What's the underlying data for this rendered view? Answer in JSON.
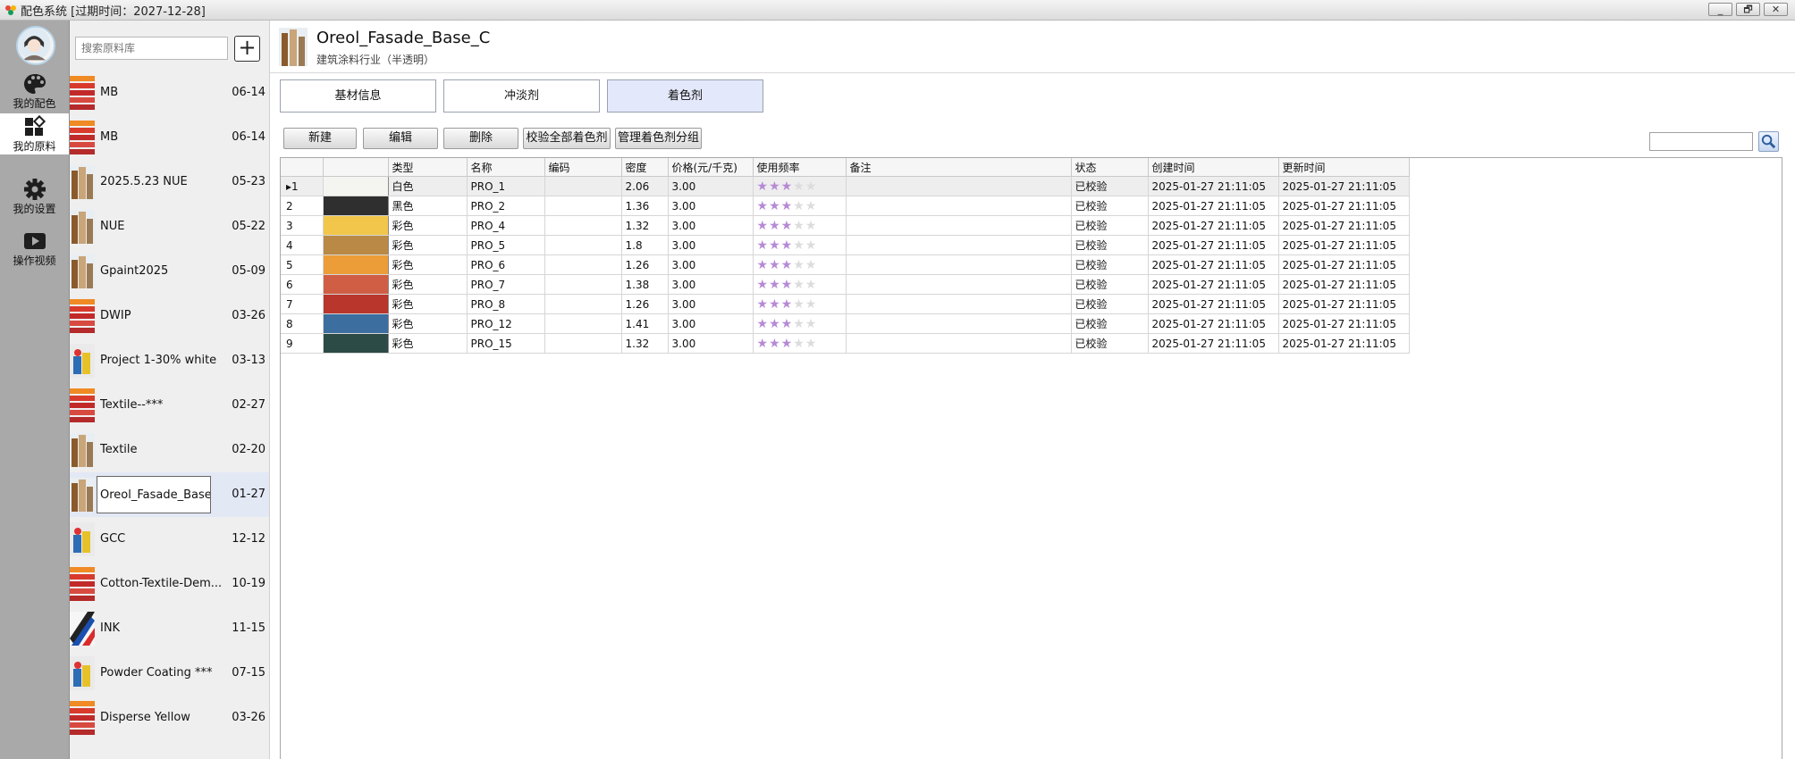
{
  "app": {
    "title": "配色系统 [过期时间：2027-12-28]",
    "window_buttons": [
      "_",
      "🗗",
      "✕"
    ]
  },
  "rail": {
    "items": [
      {
        "label": "我的配色",
        "icon": "palette-icon"
      },
      {
        "label": "我的原料",
        "icon": "materials-icon"
      },
      {
        "label": "我的设置",
        "icon": "gear-icon"
      },
      {
        "label": "操作视频",
        "icon": "video-icon"
      }
    ]
  },
  "search": {
    "placeholder": "搜索原料库",
    "add_label": "+"
  },
  "materials": [
    {
      "name": "MB",
      "date": "06-14",
      "thumb": "stripes"
    },
    {
      "name": "MB",
      "date": "06-14",
      "thumb": "stripes"
    },
    {
      "name": "2025.5.23 NUE",
      "date": "05-23",
      "thumb": "building"
    },
    {
      "name": "NUE",
      "date": "05-22",
      "thumb": "building"
    },
    {
      "name": "Gpaint2025",
      "date": "05-09",
      "thumb": "building"
    },
    {
      "name": "DWIP",
      "date": "03-26",
      "thumb": "stripes"
    },
    {
      "name": "Project 1-30% white",
      "date": "03-13",
      "thumb": "cans"
    },
    {
      "name": "Textile--***",
      "date": "02-27",
      "thumb": "stripes"
    },
    {
      "name": "Textile",
      "date": "02-20",
      "thumb": "building"
    },
    {
      "name": "Oreol_Fasade_Base_C",
      "date": "01-27",
      "thumb": "building",
      "selected": true
    },
    {
      "name": "GCC",
      "date": "12-12",
      "thumb": "cans"
    },
    {
      "name": "Cotton-Textile-Dem...",
      "date": "10-19",
      "thumb": "stripes"
    },
    {
      "name": "INK",
      "date": "11-15",
      "thumb": "ink"
    },
    {
      "name": "Powder Coating ***",
      "date": "07-15",
      "thumb": "cans"
    },
    {
      "name": "Disperse Yellow",
      "date": "03-26",
      "thumb": "stripes"
    }
  ],
  "header": {
    "title": "Oreol_Fasade_Base_C",
    "subtitle": "建筑涂料行业（半透明）"
  },
  "tabs": [
    {
      "label": "基材信息",
      "active": false
    },
    {
      "label": "冲淡剂",
      "active": false
    },
    {
      "label": "着色剂",
      "active": true
    }
  ],
  "toolbar": {
    "new_label": "新建",
    "edit_label": "编辑",
    "delete_label": "删除",
    "verify_all_label": "校验全部着色剂",
    "manage_groups_label": "管理着色剂分组"
  },
  "grid": {
    "columns": [
      "",
      "",
      "类型",
      "名称",
      "编码",
      "密度",
      "价格(元/千克)",
      "使用频率",
      "备注",
      "状态",
      "创建时间",
      "更新时间"
    ],
    "rows": [
      {
        "idx": "1",
        "color": "#f4f4f0",
        "type": "白色",
        "name": "PRO_1",
        "code": "",
        "density": "2.06",
        "price": "3.00",
        "stars": 3,
        "note": "",
        "status": "已校验",
        "created": "2025-01-27 21:11:05",
        "updated": "2025-01-27 21:11:05",
        "selected": true
      },
      {
        "idx": "2",
        "color": "#2f2f2f",
        "type": "黑色",
        "name": "PRO_2",
        "code": "",
        "density": "1.36",
        "price": "3.00",
        "stars": 3,
        "note": "",
        "status": "已校验",
        "created": "2025-01-27 21:11:05",
        "updated": "2025-01-27 21:11:05"
      },
      {
        "idx": "3",
        "color": "#f2c64a",
        "type": "彩色",
        "name": "PRO_4",
        "code": "",
        "density": "1.32",
        "price": "3.00",
        "stars": 3,
        "note": "",
        "status": "已校验",
        "created": "2025-01-27 21:11:05",
        "updated": "2025-01-27 21:11:05"
      },
      {
        "idx": "4",
        "color": "#b98945",
        "type": "彩色",
        "name": "PRO_5",
        "code": "",
        "density": "1.8",
        "price": "3.00",
        "stars": 3,
        "note": "",
        "status": "已校验",
        "created": "2025-01-27 21:11:05",
        "updated": "2025-01-27 21:11:05"
      },
      {
        "idx": "5",
        "color": "#ec9d38",
        "type": "彩色",
        "name": "PRO_6",
        "code": "",
        "density": "1.26",
        "price": "3.00",
        "stars": 3,
        "note": "",
        "status": "已校验",
        "created": "2025-01-27 21:11:05",
        "updated": "2025-01-27 21:11:05"
      },
      {
        "idx": "6",
        "color": "#cf5e44",
        "type": "彩色",
        "name": "PRO_7",
        "code": "",
        "density": "1.38",
        "price": "3.00",
        "stars": 3,
        "note": "",
        "status": "已校验",
        "created": "2025-01-27 21:11:05",
        "updated": "2025-01-27 21:11:05"
      },
      {
        "idx": "7",
        "color": "#b9362d",
        "type": "彩色",
        "name": "PRO_8",
        "code": "",
        "density": "1.26",
        "price": "3.00",
        "stars": 3,
        "note": "",
        "status": "已校验",
        "created": "2025-01-27 21:11:05",
        "updated": "2025-01-27 21:11:05"
      },
      {
        "idx": "8",
        "color": "#3c6e9f",
        "type": "彩色",
        "name": "PRO_12",
        "code": "",
        "density": "1.41",
        "price": "3.00",
        "stars": 3,
        "note": "",
        "status": "已校验",
        "created": "2025-01-27 21:11:05",
        "updated": "2025-01-27 21:11:05"
      },
      {
        "idx": "9",
        "color": "#2c4a46",
        "type": "彩色",
        "name": "PRO_15",
        "code": "",
        "density": "1.32",
        "price": "3.00",
        "stars": 3,
        "note": "",
        "status": "已校验",
        "created": "2025-01-27 21:11:05",
        "updated": "2025-01-27 21:11:05"
      }
    ]
  },
  "colors": {
    "rail_bg": "#a9a9a9",
    "selected_bg": "#e3e8f5",
    "star_on": "#b68ad6",
    "star_off": "#dcdcdc"
  }
}
